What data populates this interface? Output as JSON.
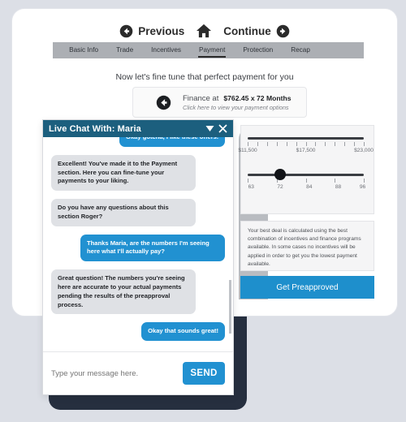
{
  "topnav": {
    "previous_label": "Previous",
    "continue_label": "Continue",
    "home_icon": "home-icon",
    "previous_icon": "arrow-left-circle-icon",
    "continue_icon": "arrow-right-circle-icon"
  },
  "tabs": [
    {
      "label": "Basic Info",
      "active": false
    },
    {
      "label": "Trade",
      "active": false
    },
    {
      "label": "Incentives",
      "active": false
    },
    {
      "label": "Payment",
      "active": true
    },
    {
      "label": "Protection",
      "active": false
    },
    {
      "label": "Recap",
      "active": false
    }
  ],
  "headline": "Now let's fine tune that perfect payment for you",
  "finance": {
    "icon": "arrow-left-circle-icon",
    "label": "Finance at",
    "amount": "$762.45 x 72 Months",
    "hint": "Click here to view your payment options"
  },
  "sliders": [
    {
      "name": "price-slider",
      "tick_labels": [
        "$11,500",
        "$17,500",
        "$23,000"
      ],
      "tick_positions": [
        0,
        50,
        100
      ],
      "tick_count": 13,
      "knob_percent": null
    },
    {
      "name": "term-slider",
      "tick_labels": [
        "63",
        "72",
        "84",
        "88",
        "96"
      ],
      "tick_positions": [
        3,
        28,
        53,
        78,
        99
      ],
      "tick_count": 5,
      "knob_percent": 28
    }
  ],
  "disclaimer": "Your best deal is calculated using the best combination of incentives and finance programs available. In some cases no incentives will be applied in order to get you the lowest payment available.",
  "preapprove_label": "Get Preapproved",
  "chat": {
    "title": "Live Chat With: Maria",
    "minimize_icon": "triangle-down-icon",
    "close_icon": "close-icon",
    "messages": [
      {
        "from": "me",
        "text": "Okay gotcha, I like these offers."
      },
      {
        "from": "them",
        "text": "Excellent! You've made it to the Payment section. Here you can fine-tune your payments to your liking."
      },
      {
        "from": "them",
        "text": "Do you have any questions about this section Roger?"
      },
      {
        "from": "me",
        "text": "Thanks Maria, are the numbers I'm seeing here what I'll actually pay?"
      },
      {
        "from": "them",
        "text": "Great question! The numbers you're seeing here are accurate to your actual payments pending the results of the preapproval process."
      },
      {
        "from": "me",
        "text": "Okay that sounds great!"
      }
    ],
    "input_placeholder": "Type your message here.",
    "input_value": "",
    "send_label": "SEND"
  },
  "colors": {
    "chat_header": "#1c5f7e",
    "accent_blue": "#2191d1",
    "button_blue": "#1e8fcc",
    "tabstrip_gray": "#acafb4",
    "page_bg": "#dcdfe6",
    "shadow_card": "#262f3f"
  }
}
